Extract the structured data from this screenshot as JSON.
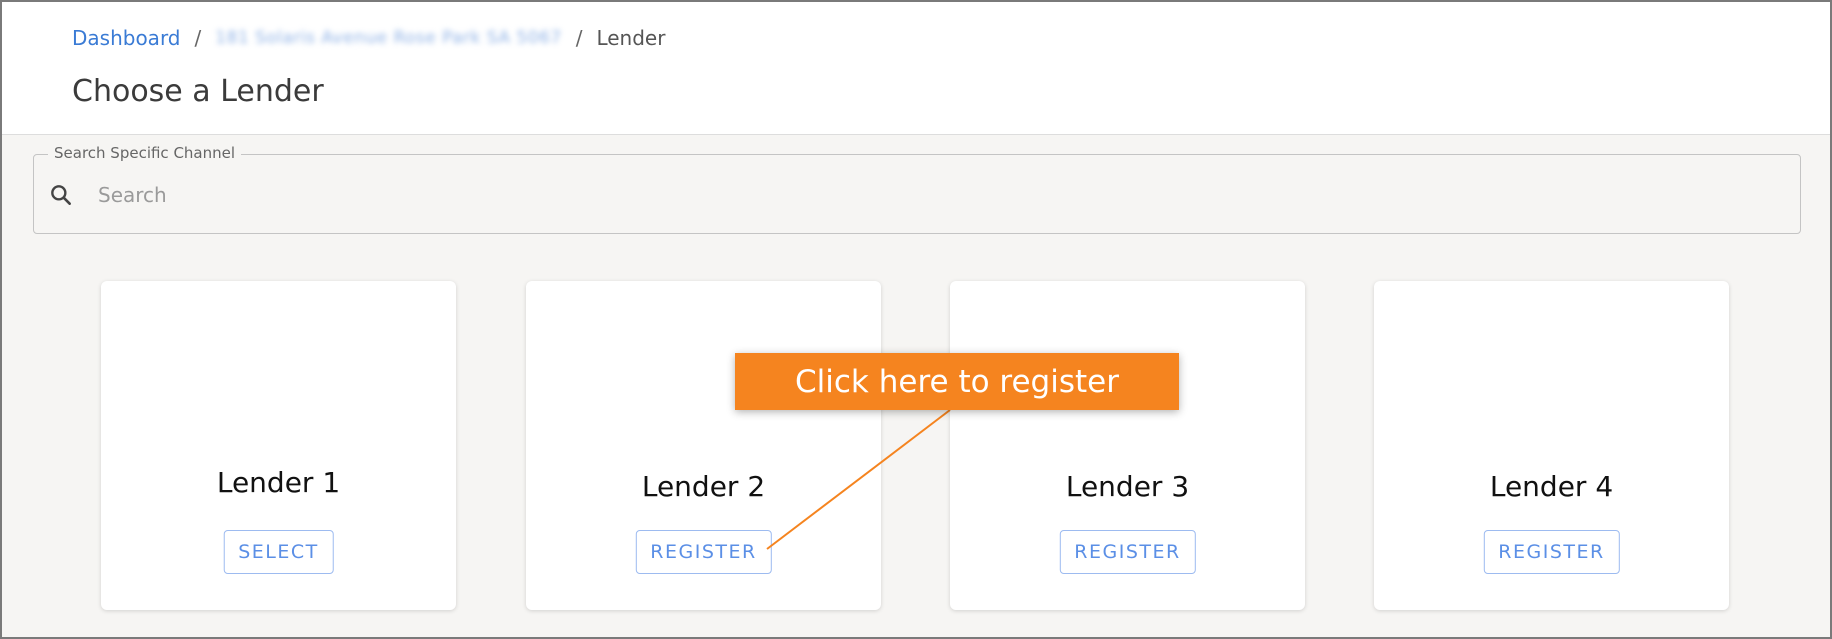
{
  "breadcrumb": {
    "dashboard": "Dashboard",
    "separator": "/",
    "address": "181 Solaris Avenue Rose Park SA 5067",
    "current": "Lender"
  },
  "page_title": "Choose a Lender",
  "search": {
    "legend": "Search Specific Channel",
    "placeholder": "Search",
    "value": ""
  },
  "lenders": [
    {
      "name": "Lender 1",
      "action": "SELECT"
    },
    {
      "name": "Lender 2",
      "action": "REGISTER"
    },
    {
      "name": "Lender 3",
      "action": "REGISTER"
    },
    {
      "name": "Lender 4",
      "action": "REGISTER"
    }
  ],
  "callout": {
    "text": "Click here to register",
    "color": "#f5841f"
  },
  "colors": {
    "link": "#3a7bd5",
    "button_text": "#5b8fe6",
    "background": "#f6f5f3"
  }
}
